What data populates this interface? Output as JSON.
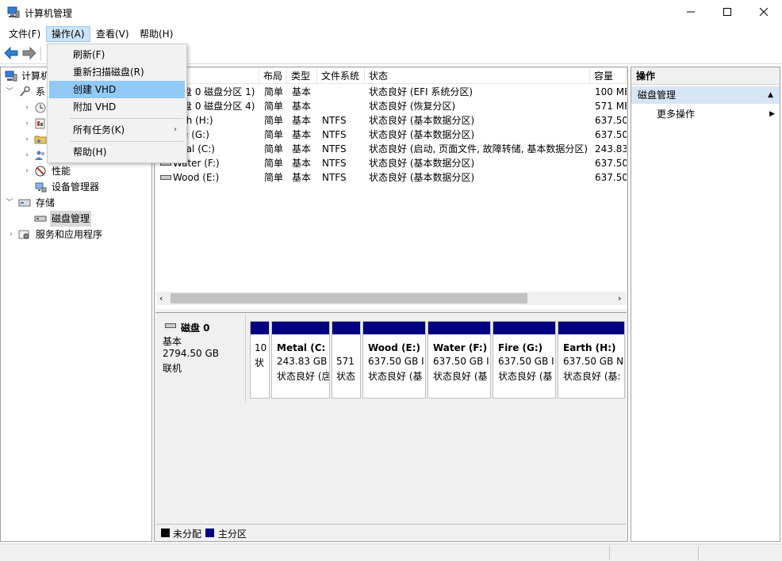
{
  "window": {
    "title": "计算机管理"
  },
  "menu": [
    {
      "label": "文件(F)"
    },
    {
      "label": "操作(A)"
    },
    {
      "label": "查看(V)"
    },
    {
      "label": "帮助(H)"
    }
  ],
  "dropdown": {
    "items": [
      {
        "label": "刷新(F)"
      },
      {
        "label": "重新扫描磁盘(R)"
      },
      {
        "label": "创建 VHD"
      },
      {
        "label": "附加 VHD"
      },
      {
        "label": "所有任务(K)"
      },
      {
        "label": "帮助(H)"
      }
    ],
    "submenu_arrow": "›"
  },
  "tree": {
    "root": "计算机",
    "system_tools": "系",
    "performance": "性能",
    "device_manager": "设备管理器",
    "storage": "存储",
    "disk_management": "磁盘管理",
    "services": "服务和应用程序"
  },
  "volume_list": {
    "columns": [
      "布局",
      "类型",
      "文件系统",
      "状态",
      "容量"
    ],
    "rows": [
      {
        "volume": "盘 0 磁盘分区 1)",
        "layout": "简单",
        "type": "基本",
        "fs": "",
        "status": "状态良好 (EFI 系统分区)",
        "capacity": "100 ME"
      },
      {
        "volume": "盘 0 磁盘分区 4)",
        "layout": "简单",
        "type": "基本",
        "fs": "",
        "status": "状态良好 (恢复分区)",
        "capacity": "571 ME"
      },
      {
        "volume": "th (H:)",
        "layout": "简单",
        "type": "基本",
        "fs": "NTFS",
        "status": "状态良好 (基本数据分区)",
        "capacity": "637.50"
      },
      {
        "volume": "e (G:)",
        "layout": "简单",
        "type": "基本",
        "fs": "NTFS",
        "status": "状态良好 (基本数据分区)",
        "capacity": "637.50"
      },
      {
        "volume": "tal (C:)",
        "layout": "简单",
        "type": "基本",
        "fs": "NTFS",
        "status": "状态良好 (启动, 页面文件, 故障转储, 基本数据分区)",
        "capacity": "243.83"
      },
      {
        "volume": "Water (F:)",
        "layout": "简单",
        "type": "基本",
        "fs": "NTFS",
        "status": "状态良好 (基本数据分区)",
        "capacity": "637.50"
      },
      {
        "volume": "Wood (E:)",
        "layout": "简单",
        "type": "基本",
        "fs": "NTFS",
        "status": "状态良好 (基本数据分区)",
        "capacity": "637.50"
      }
    ]
  },
  "disk": {
    "name": "磁盘 0",
    "kind": "基本",
    "size": "2794.50 GB",
    "state": "联机",
    "partitions": [
      {
        "name": "",
        "size": "10",
        "status": "状"
      },
      {
        "name": "Metal  (C:",
        "size": "243.83 GB",
        "status": "状态良好 (扂"
      },
      {
        "name": "",
        "size": "571",
        "status": "状态"
      },
      {
        "name": "Wood  (E:)",
        "size": "637.50 GB I",
        "status": "状态良好 (基"
      },
      {
        "name": "Water  (F:)",
        "size": "637.50 GB I",
        "status": "状态良好 (基"
      },
      {
        "name": "Fire  (G:)",
        "size": "637.50 GB I",
        "status": "状态良好 (基"
      },
      {
        "name": "Earth  (H:)",
        "size": "637.50 GB N",
        "status": "状态良好 (基:"
      }
    ]
  },
  "legend": {
    "unallocated": "未分配",
    "primary": "主分区"
  },
  "actions": {
    "header": "操作",
    "section": "磁盘管理",
    "more": "更多操作"
  },
  "colors": {
    "primary_partition": "#000080",
    "unallocated": "#000000",
    "menu_hover": "#91c9f7"
  }
}
